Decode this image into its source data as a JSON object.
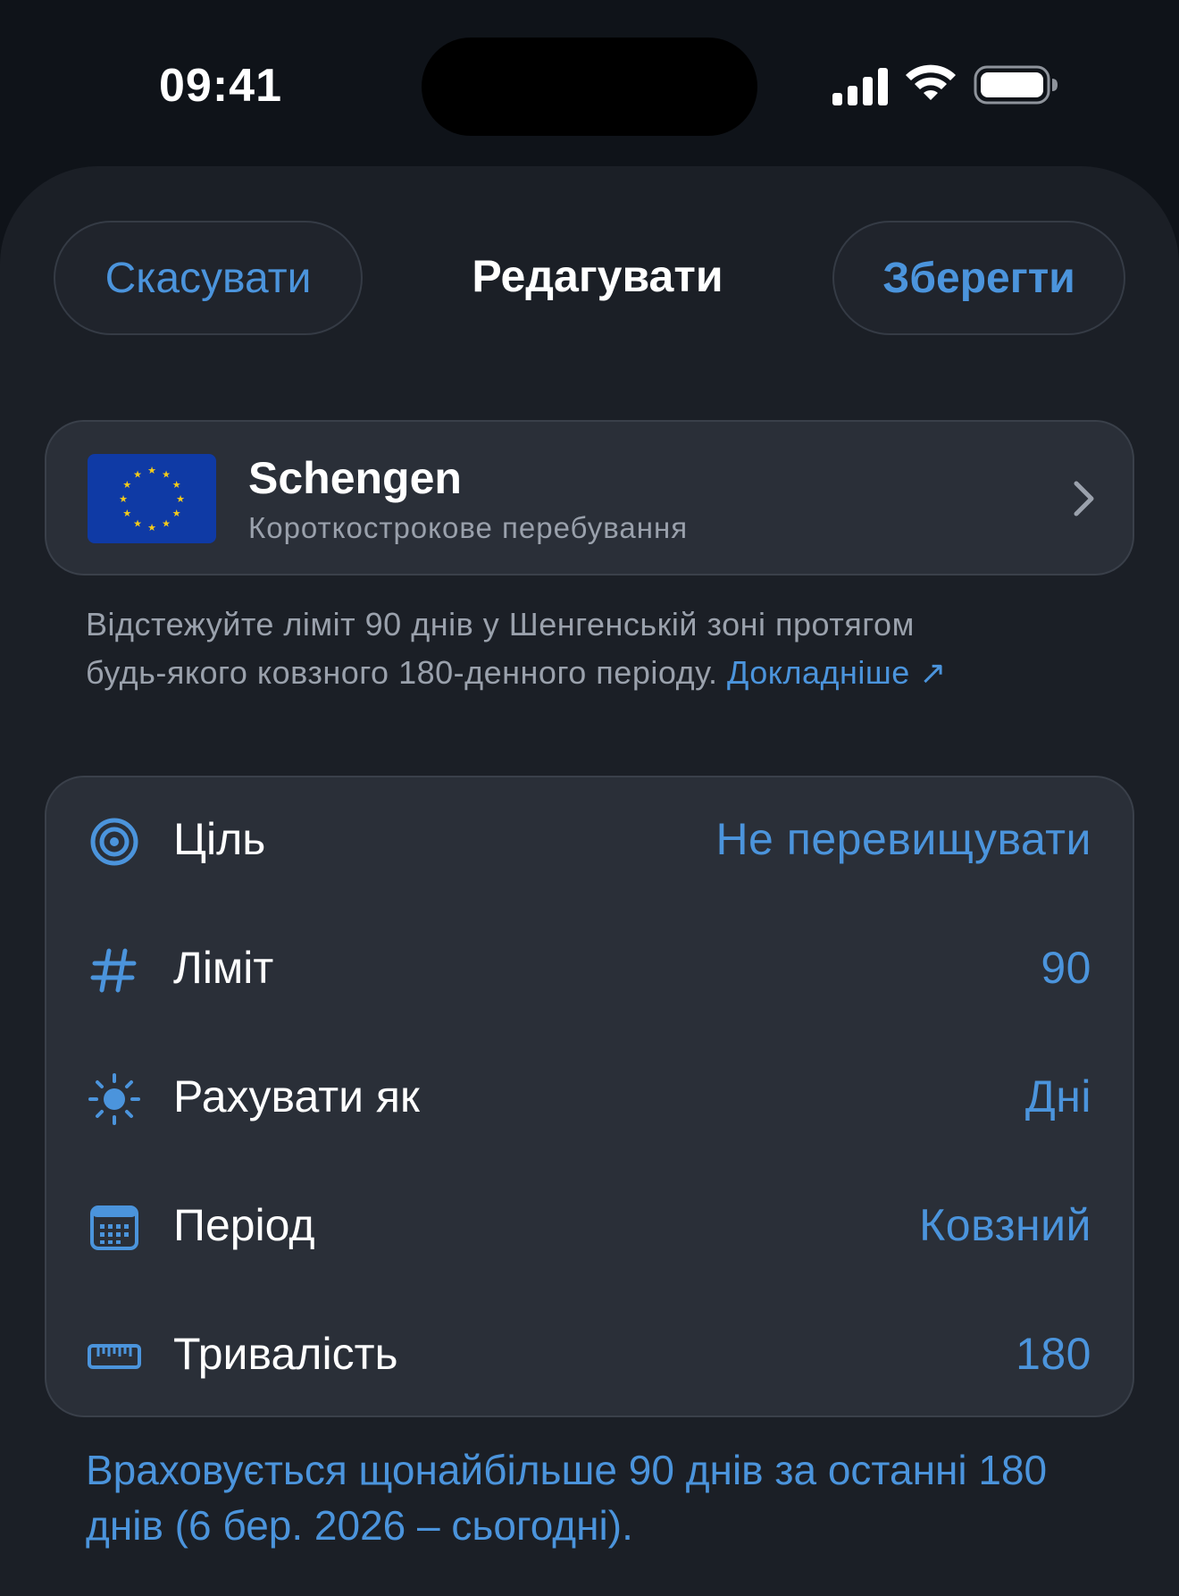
{
  "status_bar": {
    "time": "09:41",
    "icons": [
      "cellular-signal-icon",
      "wifi-icon",
      "battery-icon"
    ]
  },
  "nav": {
    "cancel_label": "Скасувати",
    "title": "Редагувати",
    "save_label": "Зберегти"
  },
  "region": {
    "flag_icon": "eu-flag-icon",
    "title": "Schengen",
    "subtitle": "Короткострокове перебування"
  },
  "description": {
    "line1": "Відстежуйте ліміт 90 днів у Шенгенській зоні протягом",
    "line2": "будь-якого ковзного 180-денного періоду.",
    "link_label": "Докладніше ↗"
  },
  "settings": {
    "rows": [
      {
        "icon": "target-icon",
        "label": "Ціль",
        "value": "Не перевищувати"
      },
      {
        "icon": "hashtag-icon",
        "label": "Ліміт",
        "value": "90"
      },
      {
        "icon": "sun-icon",
        "label": "Рахувати як",
        "value": "Дні"
      },
      {
        "icon": "calendar-icon",
        "label": "Період",
        "value": "Ковзний"
      },
      {
        "icon": "ruler-icon",
        "label": "Тривалість",
        "value": "180"
      }
    ]
  },
  "footer": {
    "note": "Враховується щонайбільше 90 днів за останні 180 днів (6 бер. 2026 – сьогодні)."
  },
  "colors": {
    "accent": "#4b94dc",
    "background": "#0f1319",
    "sheet": "#1b1f26",
    "card": "#2a2f38",
    "secondary_text": "#9aa1ac",
    "flag_blue": "#0f3aa5",
    "flag_star": "#f5cc1a"
  }
}
